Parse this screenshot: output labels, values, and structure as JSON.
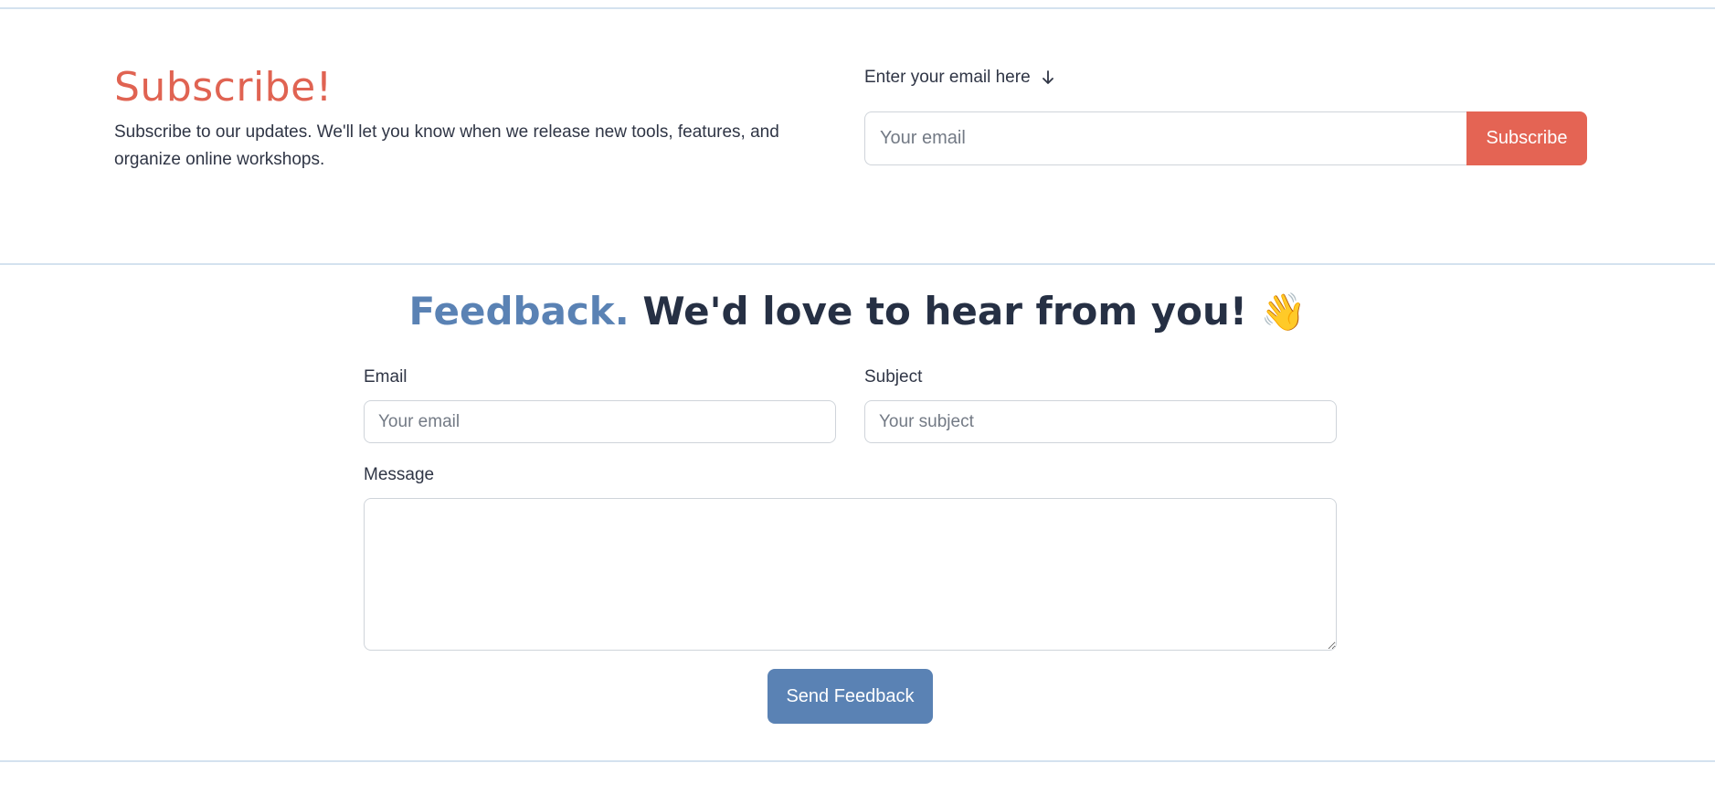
{
  "subscribe": {
    "title": "Subscribe!",
    "description": "Subscribe to our updates. We'll let you know when we release new tools, features, and organize online workshops.",
    "email_label": "Enter your email here",
    "email_label_icon": "arrow-down-icon",
    "email_placeholder": "Your email",
    "email_value": "",
    "button_label": "Subscribe"
  },
  "feedback": {
    "title_accent": "Feedback.",
    "title_rest": "We'd love to hear from you!",
    "title_emoji": "👋",
    "email_label": "Email",
    "email_placeholder": "Your email",
    "subject_label": "Subject",
    "subject_placeholder": "Your subject",
    "message_label": "Message",
    "message_value": "",
    "button_label": "Send Feedback"
  },
  "colors": {
    "subscribe_accent": "#e46454",
    "feedback_accent": "#5a82b4",
    "divider": "#d4e2ef"
  }
}
